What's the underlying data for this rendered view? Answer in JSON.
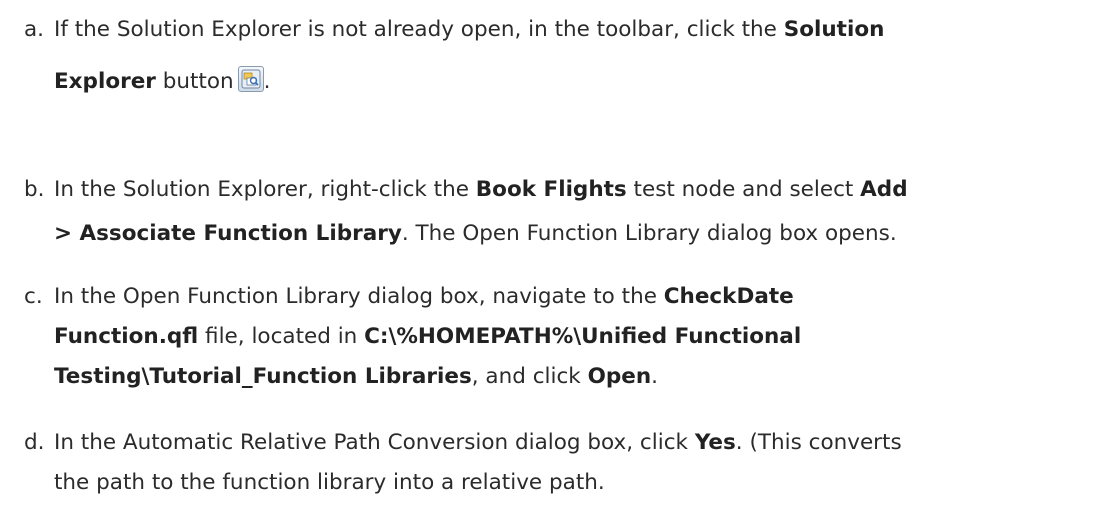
{
  "steps": [
    {
      "marker": "a.",
      "line1": {
        "t1": "If the Solution Explorer is not already open, in the toolbar, click the ",
        "b1": "Solution"
      },
      "line2": {
        "b1": "Explorer",
        "t1": " button",
        "icon": "solution-explorer-icon",
        "t2": "."
      }
    },
    {
      "marker": "b.",
      "line1": {
        "t1": "In the Solution Explorer, right-click the ",
        "b1": "Book Flights",
        "t2": " test node and select ",
        "b2": "Add"
      },
      "line2": {
        "b1": "> Associate Function Library",
        "t1": ". The Open Function Library dialog box opens."
      }
    },
    {
      "marker": "c.",
      "line1": {
        "t1": "In the Open Function Library dialog box, navigate to the ",
        "b1": "CheckDate"
      },
      "line2": {
        "b1": "Function.qfl",
        "t1": " file, located in ",
        "b2": "C:\\%HOMEPATH%\\Unified Functional"
      },
      "line3": {
        "b1": "Testing\\Tutorial_Function Libraries",
        "t1": ", and click ",
        "b2": "Open",
        "t2": "."
      }
    },
    {
      "marker": "d.",
      "line1": {
        "t1": "In the Automatic Relative Path Conversion dialog box, click ",
        "b1": "Yes",
        "t2": ". (This converts"
      },
      "line2": {
        "t1": "the path to the function library into a relative path."
      }
    }
  ]
}
